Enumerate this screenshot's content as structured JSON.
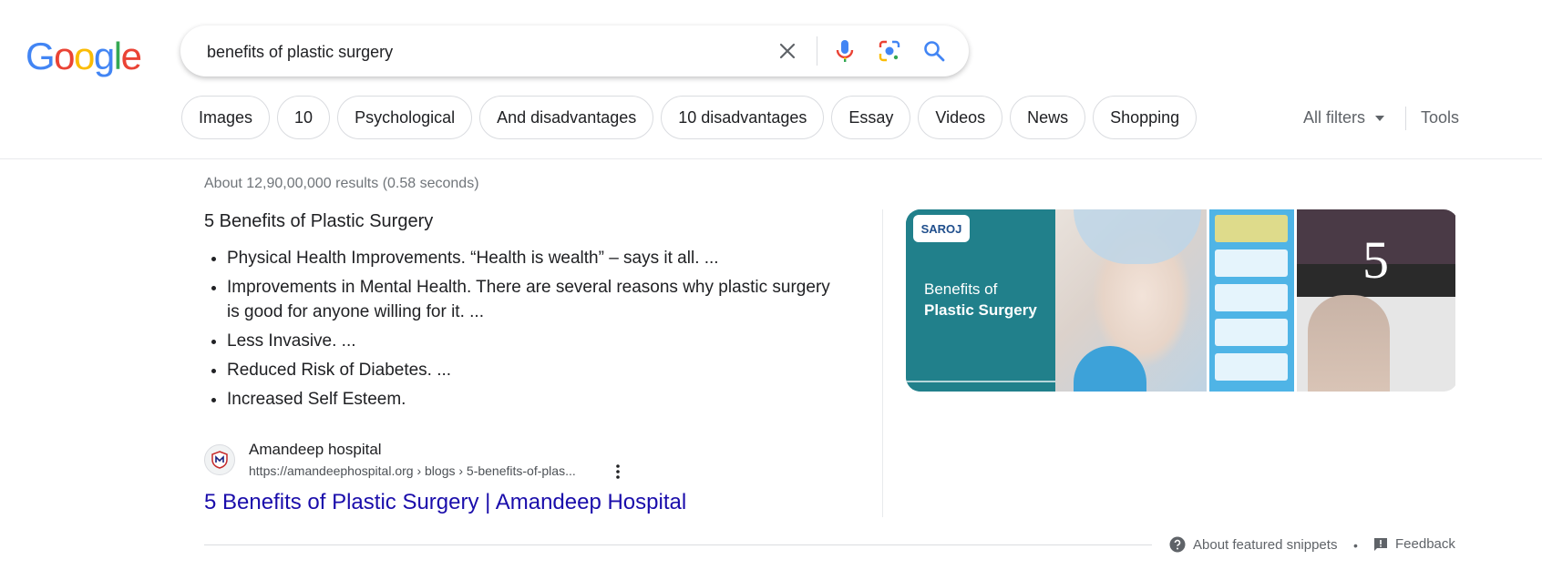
{
  "logo": {
    "letters": [
      "G",
      "o",
      "o",
      "g",
      "l",
      "e"
    ],
    "colors": [
      "#4285F4",
      "#EA4335",
      "#FBBC05",
      "#4285F4",
      "#34A853",
      "#EA4335"
    ]
  },
  "search": {
    "query": "benefits of plastic surgery"
  },
  "chips": [
    "Images",
    "10",
    "Psychological",
    "And disadvantages",
    "10 disadvantages",
    "Essay",
    "Videos",
    "News",
    "Shopping"
  ],
  "filters": {
    "all_filters": "All filters",
    "tools": "Tools"
  },
  "results": {
    "stats": "About 12,90,00,000 results (0.58 seconds)"
  },
  "snippet": {
    "title": "5 Benefits of Plastic Surgery",
    "bullets": [
      "Physical Health Improvements. “Health is wealth” – says it all. ...",
      "Improvements in Mental Health. There are several reasons why plastic surgery is good for anyone willing for it. ...",
      "Less Invasive. ...",
      "Reduced Risk of Diabetes. ...",
      "Increased Self Esteem."
    ],
    "source": {
      "site_name": "Amandeep hospital",
      "url": "https://amandeephospital.org › blogs › 5-benefits-of-plas...",
      "link_title": "5 Benefits of Plastic Surgery | Amandeep Hospital"
    }
  },
  "images": {
    "img1_logo": "SAROJ",
    "img1_line1": "Benefits of",
    "img1_line2": "Plastic Surgery",
    "img3_number": "5"
  },
  "footer": {
    "about_snippets": "About featured snippets",
    "separator": "•",
    "feedback": "Feedback"
  },
  "colors": {
    "link": "#1a0dab",
    "muted": "#5f6368",
    "accent_blue": "#4285F4"
  }
}
